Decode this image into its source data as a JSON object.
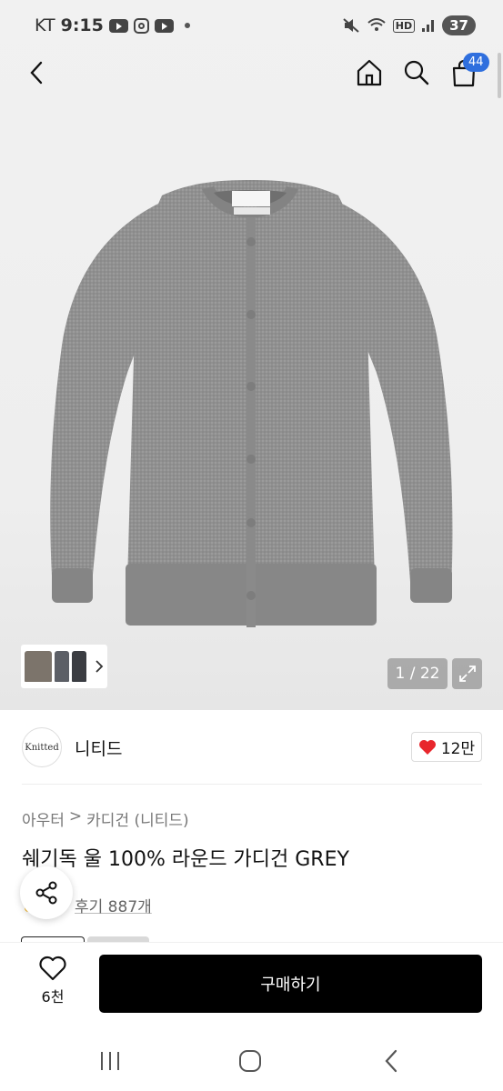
{
  "status_bar": {
    "carrier": "KT",
    "time": "9:15",
    "hd": "HD",
    "battery": "37"
  },
  "nav": {
    "back_icon": "chevron-left-icon",
    "home_icon": "home-icon",
    "search_icon": "search-icon",
    "cart_icon": "shopping-bag-icon",
    "cart_count": "44"
  },
  "gallery": {
    "counter": "1 / 22",
    "expand_icon": "expand-icon"
  },
  "brand": {
    "logo_text": "Knitted",
    "name": "니티드",
    "likes": "12만"
  },
  "breadcrumb": {
    "category": "아우터",
    "separator": ">",
    "subcategory": "카디건 (니티드)"
  },
  "product": {
    "title": "쉐기독 울 100% 라운드 가디건 GREY",
    "reviews": "후기 887개"
  },
  "bottom_bar": {
    "wish_count": "6천",
    "buy_label": "구매하기"
  },
  "colors": {
    "cardigan": "#8f8f8f",
    "buy_button": "#000000",
    "cart_badge": "#2f6fde",
    "heart": "#e8262c"
  }
}
